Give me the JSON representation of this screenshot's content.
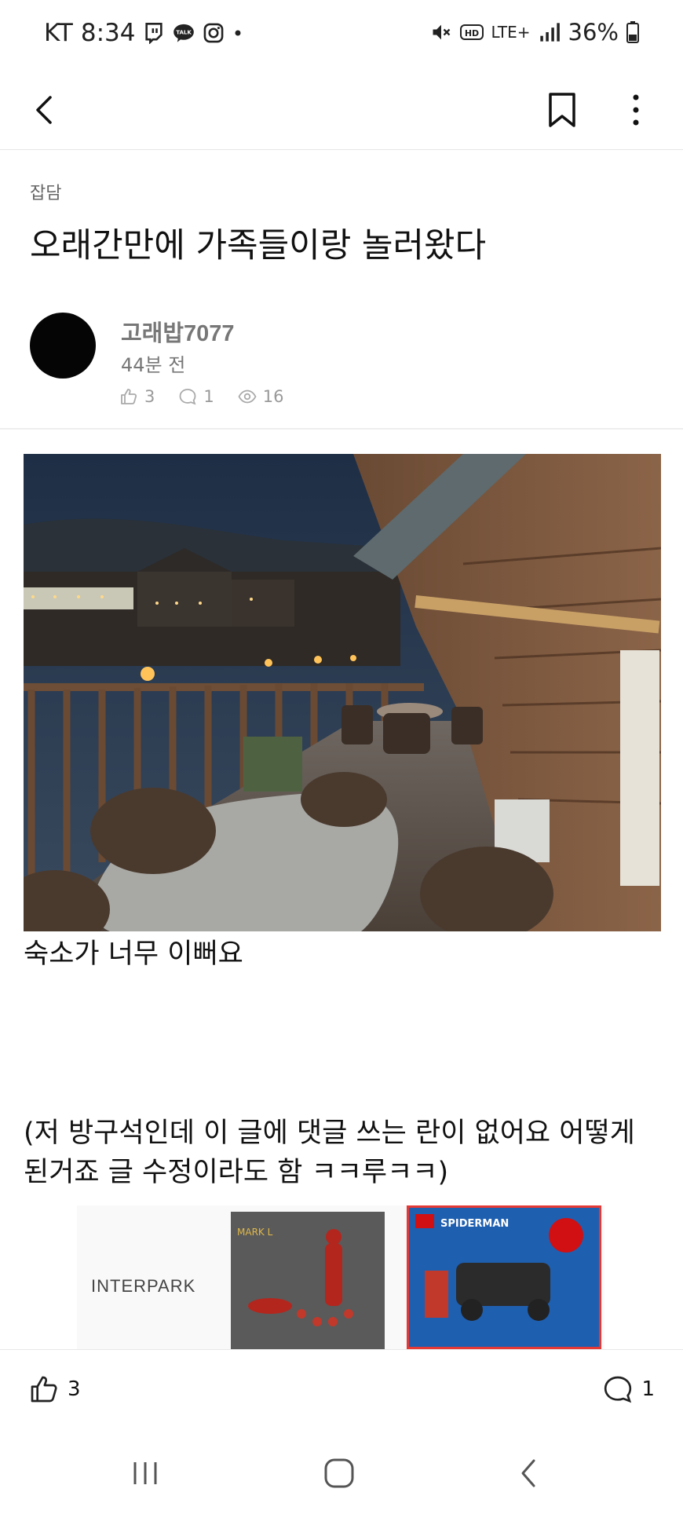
{
  "status": {
    "carrier": "KT",
    "time": "8:34",
    "network": "LTE+",
    "battery": "36%"
  },
  "post": {
    "category": "잡담",
    "title": "오래간만에 가족들이랑 놀러왔다",
    "author": "고래밥7077",
    "time_ago": "44분 전",
    "likes": "3",
    "comments": "1",
    "views": "16",
    "body_line1": "숙소가 너무 이뻐요",
    "body_line2": "(저 방구석인데 이 글에 댓글 쓰는 란이 없어요 어떻게 된거죠 글 수정이라도 함 ㅋㅋ루ㅋㅋ)"
  },
  "ad": {
    "brand": "INTERPARK",
    "product1_label": "MARK L",
    "product2_label": "SPIDERMAN"
  },
  "bottom": {
    "likes": "3",
    "comments": "1"
  },
  "icons": [
    "back-arrow-icon",
    "bookmark-icon",
    "more-vert-icon",
    "thumbs-up-icon",
    "comment-icon",
    "eye-icon"
  ],
  "colors": {
    "accent_ad_border": "#e53935"
  }
}
